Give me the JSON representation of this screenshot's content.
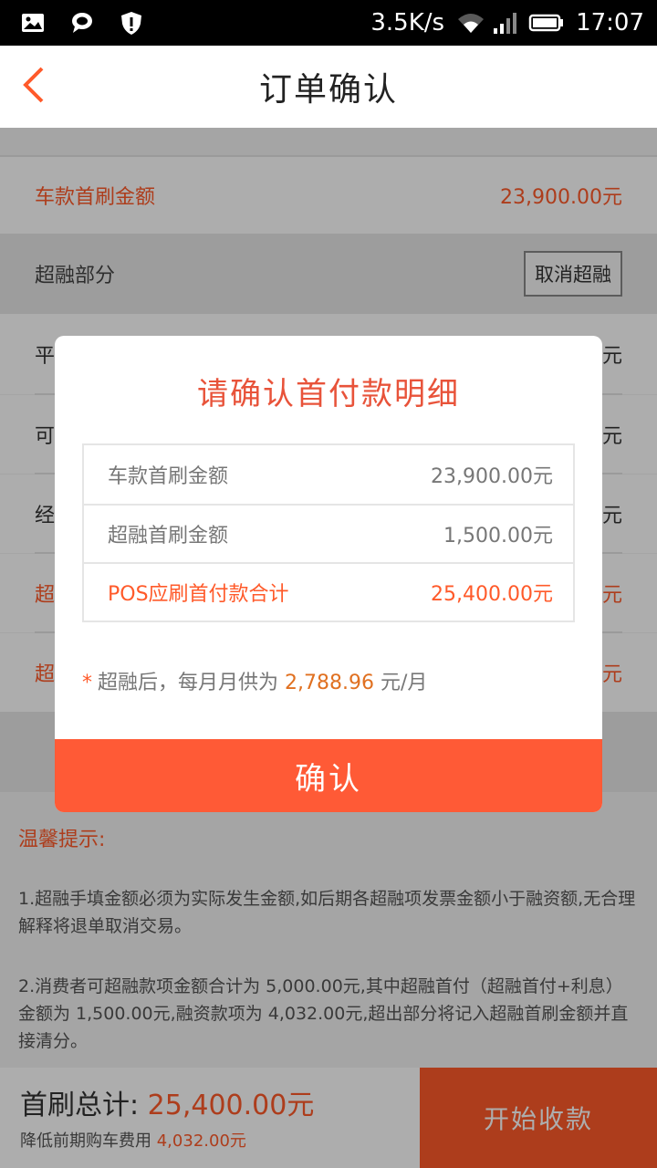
{
  "status_bar": {
    "net_speed": "3.5K/s",
    "time": "17:07"
  },
  "header": {
    "title": "订单确认"
  },
  "main": {
    "first_payment_row": {
      "label": "车款首刷金额",
      "value": "23,900.00元"
    },
    "super_finance": {
      "label": "超融部分",
      "cancel_label": "取消超融"
    },
    "partial_rows": [
      {
        "label": "平",
        "value": "元"
      },
      {
        "label": "可",
        "value": "元"
      },
      {
        "label": "经",
        "value": "元"
      },
      {
        "label": "超",
        "value": "元"
      },
      {
        "label": "超",
        "value": "元"
      }
    ],
    "tips": {
      "title": "温馨提示:",
      "items": [
        "1.超融手填金额必须为实际发生金额,如后期各超融项发票金额小于融资额,无合理解释将退单取消交易。",
        "2.消费者可超融款项金额合计为 5,000.00元,其中超融首付（超融首付+利息）金额为 1,500.00元,融资款项为 4,032.00元,超出部分将记入超融首刷金额并直接清分。"
      ]
    }
  },
  "bottom_bar": {
    "total_label": "首刷总计: ",
    "total_value": "25,400.00元",
    "sub_label": "降低前期购车费用 ",
    "sub_value": "4,032.00元",
    "start_button": "开始收款"
  },
  "dialog": {
    "title": "请确认首付款明细",
    "rows": [
      {
        "label": "车款首刷金额",
        "value": "23,900.00元"
      },
      {
        "label": "超融首刷金额",
        "value": "1,500.00元"
      },
      {
        "label": "POS应刷首付款合计",
        "value": "25,400.00元"
      }
    ],
    "note_star": "*",
    "note_prefix": "超融后，每月月供为 ",
    "note_amount": "2,788.96",
    "note_suffix": " 元/月",
    "confirm_label": "确认"
  },
  "colors": {
    "accent": "#ff5a2a",
    "dialog_title": "#e8533a",
    "confirm_button": "#ff5a36"
  },
  "icons": [
    "image-icon",
    "chat-bubble-icon",
    "shield-icon",
    "wifi-icon",
    "signal-icon",
    "battery-icon",
    "back-arrow-icon"
  ]
}
